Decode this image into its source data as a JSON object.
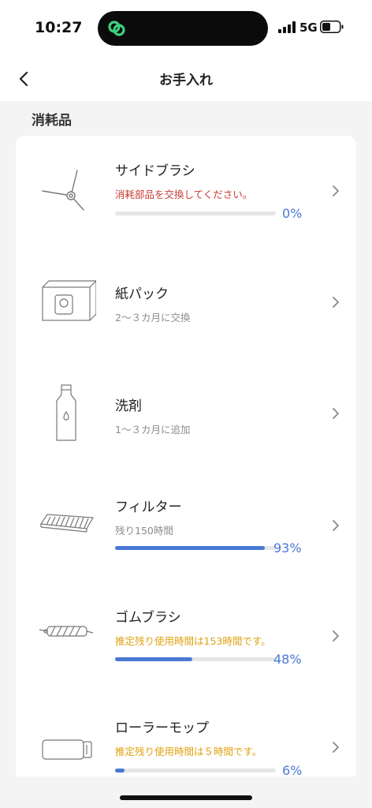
{
  "status_bar": {
    "time": "10:27",
    "network": "5G"
  },
  "nav": {
    "title": "お手入れ"
  },
  "section": {
    "title": "消耗品"
  },
  "items": [
    {
      "name": "サイドブラシ",
      "subtitle": "消耗部品を交換してください。",
      "subtitle_style": "warning-red",
      "has_progress": true,
      "percent": 0,
      "percent_label": "0%",
      "icon": "side-brush-icon"
    },
    {
      "name": "紙パック",
      "subtitle": "2～３カ月に交換",
      "subtitle_style": "normal",
      "has_progress": false,
      "icon": "dust-bag-icon"
    },
    {
      "name": "洗剤",
      "subtitle": "1～３カ月に追加",
      "subtitle_style": "normal",
      "has_progress": false,
      "icon": "detergent-bottle-icon"
    },
    {
      "name": "フィルター",
      "subtitle": "残り150時間",
      "subtitle_style": "normal",
      "has_progress": true,
      "percent": 93,
      "percent_label": "93%",
      "icon": "filter-icon"
    },
    {
      "name": "ゴムブラシ",
      "subtitle": "推定残り使用時間は153時間です。",
      "subtitle_style": "warning-orange",
      "has_progress": true,
      "percent": 48,
      "percent_label": "48%",
      "icon": "rubber-brush-icon"
    },
    {
      "name": "ローラーモップ",
      "subtitle": "推定残り使用時間は５時間です。",
      "subtitle_style": "warning-orange",
      "has_progress": true,
      "percent": 6,
      "percent_label": "6%",
      "icon": "roller-mop-icon"
    }
  ],
  "colors": {
    "accent": "#4a78d4",
    "warning_red": "#c83a32",
    "warning_orange": "#dfa20f",
    "background": "#f4f4f4"
  }
}
